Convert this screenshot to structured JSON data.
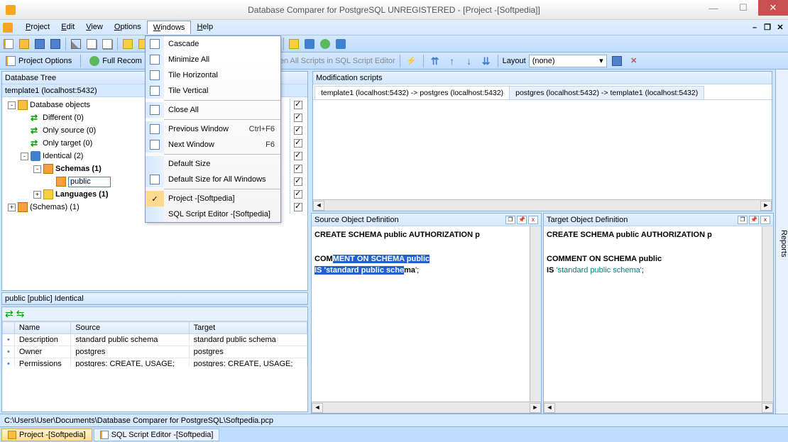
{
  "title": "Database Comparer for PostgreSQL UNREGISTERED - [Project -[Softpedia]]",
  "menu": {
    "items": [
      "Project",
      "Edit",
      "View",
      "Options",
      "Windows",
      "Help"
    ],
    "active": "Windows"
  },
  "dropdown": {
    "items": [
      {
        "label": "Cascade",
        "icon": "cascade"
      },
      {
        "label": "Minimize All",
        "icon": "min"
      },
      {
        "label": "Tile Horizontal",
        "icon": "tileh"
      },
      {
        "label": "Tile Vertical",
        "icon": "tilev"
      },
      {
        "sep": true
      },
      {
        "label": "Close All",
        "icon": "close"
      },
      {
        "sep": true
      },
      {
        "label": "Previous Window",
        "icon": "prev",
        "shortcut": "Ctrl+F6"
      },
      {
        "label": "Next Window",
        "icon": "next",
        "shortcut": "F6"
      },
      {
        "sep": true
      },
      {
        "label": "Default Size",
        "icon": ""
      },
      {
        "label": "Default Size for All Windows",
        "icon": "defall"
      },
      {
        "sep": true
      },
      {
        "label": "Project -[Softpedia]",
        "icon": "orange",
        "checked": true
      },
      {
        "label": "SQL Script Editor -[Softpedia]",
        "icon": ""
      }
    ]
  },
  "toolbar2": {
    "project_options": "Project Options",
    "full_recompare": "Full Recom",
    "open_scripts": "en All Scripts in SQL Script Editor",
    "layout_label": "Layout",
    "layout_value": "(none)"
  },
  "tree": {
    "header": "Database Tree",
    "root": "template1 (localhost:5432)",
    "nodes": [
      {
        "indent": 0,
        "toggle": "-",
        "icon": "db",
        "label": "Database objects",
        "check": true
      },
      {
        "indent": 1,
        "toggle": "",
        "icon": "diff",
        "label": "Different (0)",
        "check": true
      },
      {
        "indent": 1,
        "toggle": "",
        "icon": "diff",
        "label": "Only source (0)",
        "check": true
      },
      {
        "indent": 1,
        "toggle": "",
        "icon": "diff",
        "label": "Only target (0)",
        "check": true
      },
      {
        "indent": 1,
        "toggle": "-",
        "icon": "same",
        "label": "Identical (2)",
        "check": true
      },
      {
        "indent": 2,
        "toggle": "-",
        "icon": "schema",
        "label": "Schemas (1)",
        "bold": true,
        "check": true
      },
      {
        "indent": 3,
        "toggle": "",
        "icon": "schema",
        "label": "public",
        "input": true,
        "check": true
      },
      {
        "indent": 2,
        "toggle": "+",
        "icon": "lang",
        "label": "Languages (1)",
        "bold": true,
        "check": true
      },
      {
        "indent": 0,
        "toggle": "+",
        "icon": "schema",
        "label": "(Schemas) (1)",
        "check": true
      }
    ]
  },
  "info_bar": "public [public] Identical",
  "grid": {
    "headers": [
      "Name",
      "Source",
      "Target"
    ],
    "rows": [
      [
        "Description",
        "standard public schema",
        "standard public schema"
      ],
      [
        "Owner",
        "postgres",
        "postgres"
      ],
      [
        "Permissions",
        "postgres: CREATE, USAGE;",
        "postgres: CREATE, USAGE;"
      ]
    ]
  },
  "mod": {
    "header": "Modification scripts",
    "tabs": [
      "template1 (localhost:5432) -> postgres (localhost:5432)",
      "postgres (localhost:5432) -> template1 (localhost:5432)"
    ]
  },
  "src_def": {
    "header": "Source Object Definition",
    "line1a": "CREATE SCHEMA public AUTHORIZATION p",
    "line2_pre": "COM",
    "line2_hl": "MENT ON SCHEMA public",
    "line3_hl": "IS 'standard public sche",
    "line3_post_hl": "ma",
    "line3_end": "';"
  },
  "tgt_def": {
    "header": "Target Object Definition",
    "line1": "CREATE SCHEMA public AUTHORIZATION p",
    "line2": "COMMENT ON SCHEMA public",
    "line3a": "IS ",
    "line3b": "'standard public schema'",
    "line3c": ";"
  },
  "status": "C:\\Users\\User\\Documents\\Database Comparer for PostgreSQL\\Softpedia.pcp",
  "bottom_tabs": [
    "Project -[Softpedia]",
    "SQL Script Editor -[Softpedia]"
  ],
  "reports": "Reports"
}
